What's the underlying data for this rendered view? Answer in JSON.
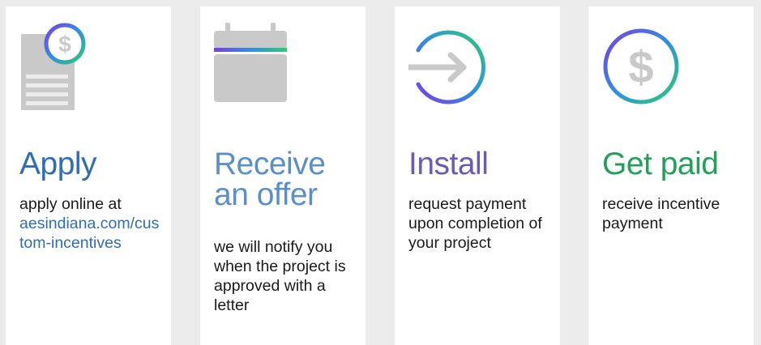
{
  "steps": [
    {
      "icon": "document-dollar-icon",
      "title": "Apply",
      "title_color": "#2f6db5",
      "description": "apply online at",
      "link_text": "aesindiana.com/custom-incentives"
    },
    {
      "icon": "calendar-icon",
      "title": "Receive an offer",
      "title_color": "#5b8fcb",
      "description": "we will notify you when the project is approved with a letter"
    },
    {
      "icon": "arrow-circle-icon",
      "title": "Install",
      "title_color": "#6c5bb0",
      "description": "request payment upon completion of your project"
    },
    {
      "icon": "dollar-circle-icon",
      "title": "Get paid",
      "title_color": "#22a05a",
      "description": "receive incentive payment"
    }
  ]
}
